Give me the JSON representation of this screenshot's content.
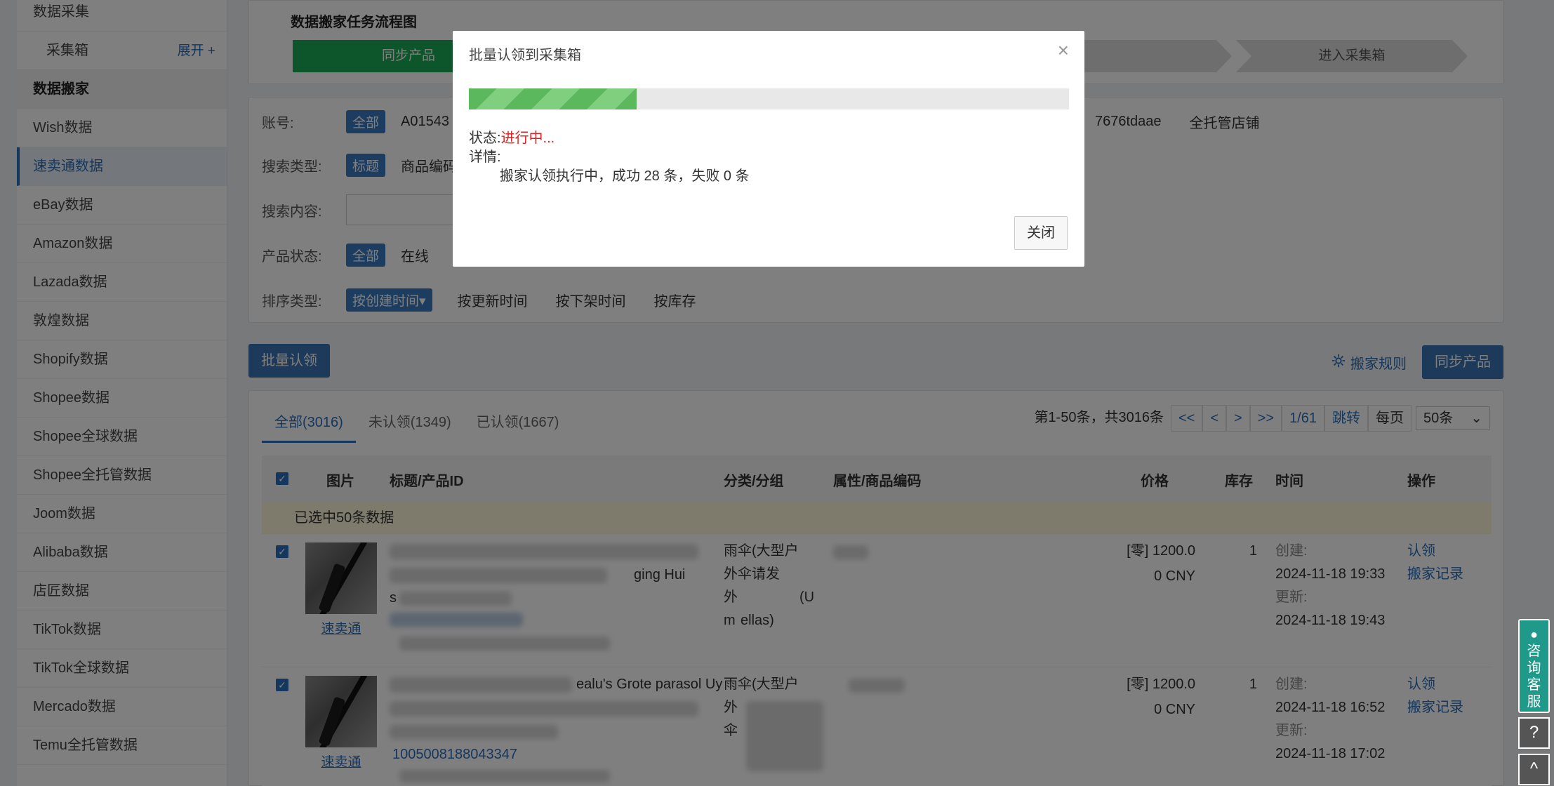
{
  "sidebar": {
    "items": [
      {
        "label": "数据采集",
        "kind": "plain"
      },
      {
        "label": "采集箱",
        "kind": "sub",
        "expand": "展开 +"
      },
      {
        "label": "数据搬家",
        "kind": "group"
      },
      {
        "label": "Wish数据",
        "kind": "plain"
      },
      {
        "label": "速卖通数据",
        "kind": "active"
      },
      {
        "label": "eBay数据",
        "kind": "plain"
      },
      {
        "label": "Amazon数据",
        "kind": "plain"
      },
      {
        "label": "Lazada数据",
        "kind": "plain"
      },
      {
        "label": "敦煌数据",
        "kind": "plain"
      },
      {
        "label": "Shopify数据",
        "kind": "plain"
      },
      {
        "label": "Shopee数据",
        "kind": "plain"
      },
      {
        "label": "Shopee全球数据",
        "kind": "plain"
      },
      {
        "label": "Shopee全托管数据",
        "kind": "plain"
      },
      {
        "label": "Joom数据",
        "kind": "plain"
      },
      {
        "label": "Alibaba数据",
        "kind": "plain"
      },
      {
        "label": "店匠数据",
        "kind": "plain"
      },
      {
        "label": "TikTok数据",
        "kind": "plain"
      },
      {
        "label": "TikTok全球数据",
        "kind": "plain"
      },
      {
        "label": "Mercado数据",
        "kind": "plain"
      },
      {
        "label": "Temu全托管数据",
        "kind": "plain"
      }
    ]
  },
  "flow": {
    "title": "数据搬家任务流程图",
    "steps": [
      "同步产品",
      "",
      "",
      "",
      "进入采集箱"
    ]
  },
  "filters": {
    "account_label": "账号:",
    "account_all": "全部",
    "account_first": "A01543",
    "account_mid": "7676tdaae",
    "account_last": "全托管店铺",
    "search_type_label": "搜索类型:",
    "search_type_tag": "标题",
    "search_type_opt": "商品编码",
    "search_content_label": "搜索内容:",
    "status_label": "产品状态:",
    "status_all": "全部",
    "status_online": "在线",
    "sort_label": "排序类型:",
    "sort_active": "按创建时间▾",
    "sort_opts": [
      "按更新时间",
      "按下架时间",
      "按库存"
    ]
  },
  "actions": {
    "batch_claim": "批量认领",
    "rules": "搬家规则",
    "sync": "同步产品"
  },
  "tabs": [
    "全部(3016)",
    "未认领(1349)",
    "已认领(1667)"
  ],
  "pager": {
    "summary": "第1-50条，共3016条",
    "first": "<<",
    "prev": "<",
    "next": ">",
    "last": ">>",
    "page": "1/61",
    "jump": "跳转",
    "per_label": "每页",
    "per_value": "50条"
  },
  "table": {
    "headers": {
      "image": "图片",
      "title": "标题/产品ID",
      "category": "分类/分组",
      "attr": "属性/商品编码",
      "price": "价格",
      "stock": "库存",
      "time": "时间",
      "op": "操作"
    },
    "selected_note": "已选中50条数据",
    "rows": [
      {
        "platform": "速卖通",
        "title_visible": "ging Hui",
        "title_visible2": "s",
        "category": "雨伞(大型户外伞请发 (Umbrellas)",
        "category_l1": "雨伞(大型户",
        "category_l2": "外伞请发",
        "category_l3": "外",
        "category_l4": "(U",
        "category_l5": "m",
        "category_l6": "ellas)",
        "price_l1": "[零] 1200.0",
        "price_l2": "0  CNY",
        "stock": "1",
        "created_label": "创建:",
        "created": "2024-11-18 19:33",
        "updated_label": "更新:",
        "updated": "2024-11-18 19:43",
        "op1": "认领",
        "op2": "搬家记录"
      },
      {
        "platform": "速卖通",
        "title_visible": "ealu's Grote parasol Uy",
        "title_id": "1005008188043347",
        "category_l1": "雨伞(大型户",
        "category_l2": "外",
        "category_l3": "伞",
        "price_l1": "[零] 1200.0",
        "price_l2": "0  CNY",
        "stock": "1",
        "created_label": "创建:",
        "created": "2024-11-18 16:52",
        "updated_label": "更新:",
        "updated": "2024-11-18 17:02",
        "op1": "认领",
        "op2": "搬家记录"
      }
    ]
  },
  "modal": {
    "title": "批量认领到采集箱",
    "close_x": "×",
    "progress": 0.28,
    "status_label": "状态:",
    "status_value": "进行中...",
    "detail_label": "详情:",
    "detail_text": "搬家认领执行中，成功 28 条，失败 0 条",
    "close_button": "关闭"
  },
  "float": {
    "consult": "咨询客服",
    "help": "?",
    "top": "^"
  },
  "colors": {
    "primary": "#3a74b4",
    "success": "#1aad56",
    "danger": "#e02020"
  }
}
